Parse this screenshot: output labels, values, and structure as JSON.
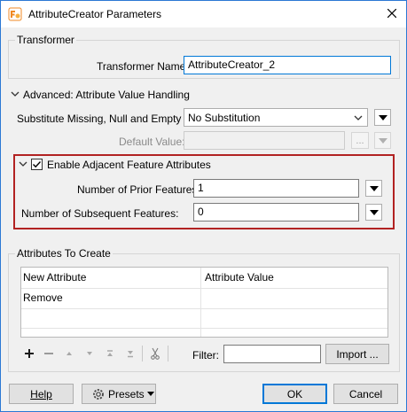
{
  "window": {
    "title": "AttributeCreator Parameters"
  },
  "transformer": {
    "group_label": "Transformer",
    "name_label": "Transformer Name:",
    "name_value": "AttributeCreator_2"
  },
  "advanced": {
    "group_label": "Advanced: Attribute Value Handling",
    "substitute_label": "Substitute Missing, Null and Empty by:",
    "substitute_value": "No Substitution",
    "default_label": "Default Value:",
    "default_value": "",
    "ellipsis": "..."
  },
  "adjacent": {
    "label": "Enable Adjacent Feature Attributes",
    "checked": true,
    "prior_label": "Number of Prior Features:",
    "prior_value": "1",
    "subsequent_label": "Number of Subsequent Features:",
    "subsequent_value": "0"
  },
  "attributes": {
    "group_label": "Attributes To Create",
    "columns": [
      "New Attribute",
      "Attribute Value"
    ],
    "rows": [
      [
        "Remove",
        ""
      ],
      [
        "",
        ""
      ]
    ],
    "filter_label": "Filter:",
    "filter_value": "",
    "import_label": "Import ..."
  },
  "footer": {
    "help": "Help",
    "presets": "Presets",
    "ok": "OK",
    "cancel": "Cancel"
  },
  "colors": {
    "accent": "#0078d7",
    "highlight": "#b22222",
    "window_border": "#2b78d4"
  }
}
